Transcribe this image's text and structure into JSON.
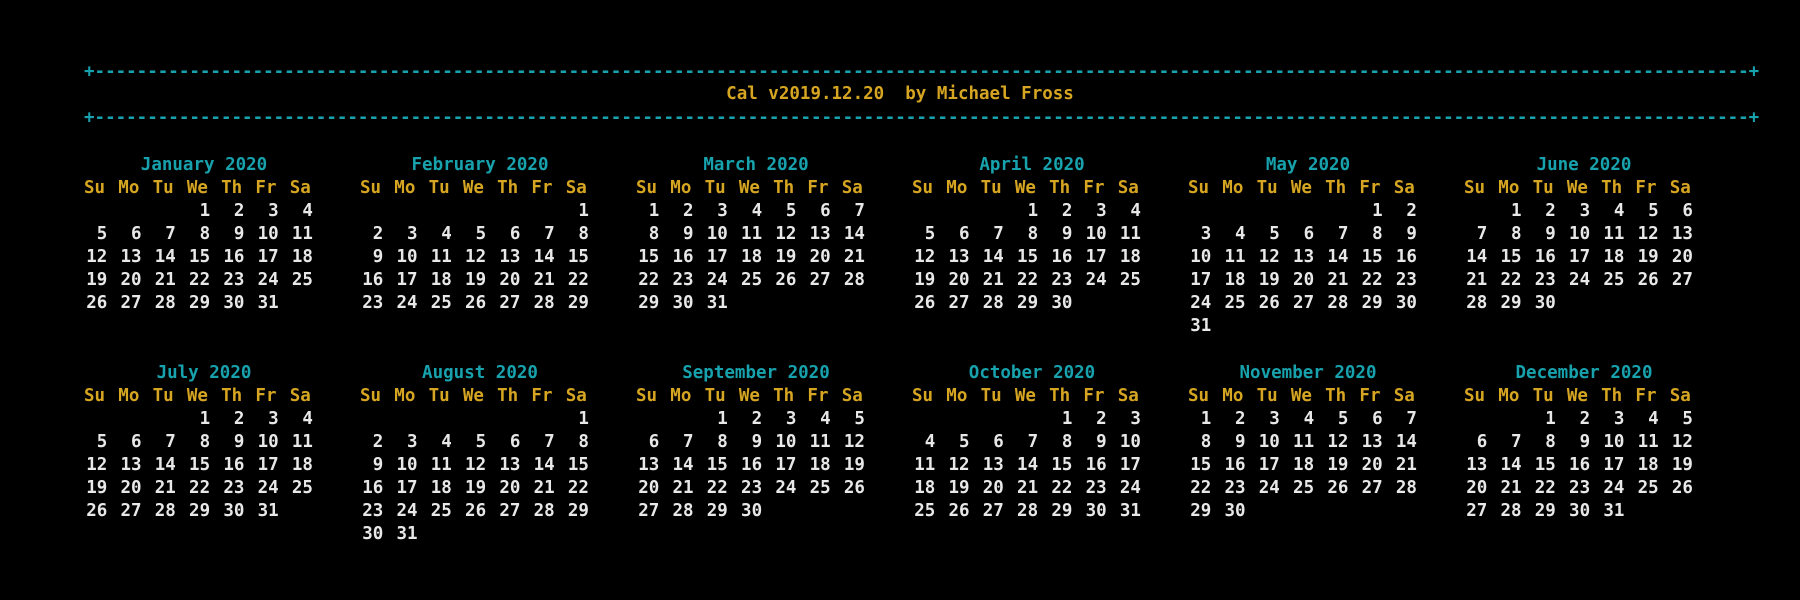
{
  "rule": "+-------------------------------------------------------------------------------------------------------------------------------------------------------------+",
  "title": "Cal v2019.12.20  by Michael Fross",
  "dow": [
    "Su",
    "Mo",
    "Tu",
    "We",
    "Th",
    "Fr",
    "Sa"
  ],
  "months": [
    {
      "name": "January 2020",
      "weeks": [
        [
          "",
          "",
          "",
          "1",
          "2",
          "3",
          "4"
        ],
        [
          "5",
          "6",
          "7",
          "8",
          "9",
          "10",
          "11"
        ],
        [
          "12",
          "13",
          "14",
          "15",
          "16",
          "17",
          "18"
        ],
        [
          "19",
          "20",
          "21",
          "22",
          "23",
          "24",
          "25"
        ],
        [
          "26",
          "27",
          "28",
          "29",
          "30",
          "31",
          ""
        ]
      ]
    },
    {
      "name": "February 2020",
      "weeks": [
        [
          "",
          "",
          "",
          "",
          "",
          "",
          "1"
        ],
        [
          "2",
          "3",
          "4",
          "5",
          "6",
          "7",
          "8"
        ],
        [
          "9",
          "10",
          "11",
          "12",
          "13",
          "14",
          "15"
        ],
        [
          "16",
          "17",
          "18",
          "19",
          "20",
          "21",
          "22"
        ],
        [
          "23",
          "24",
          "25",
          "26",
          "27",
          "28",
          "29"
        ]
      ]
    },
    {
      "name": "March 2020",
      "weeks": [
        [
          "1",
          "2",
          "3",
          "4",
          "5",
          "6",
          "7"
        ],
        [
          "8",
          "9",
          "10",
          "11",
          "12",
          "13",
          "14"
        ],
        [
          "15",
          "16",
          "17",
          "18",
          "19",
          "20",
          "21"
        ],
        [
          "22",
          "23",
          "24",
          "25",
          "26",
          "27",
          "28"
        ],
        [
          "29",
          "30",
          "31",
          "",
          "",
          "",
          ""
        ]
      ]
    },
    {
      "name": "April 2020",
      "weeks": [
        [
          "",
          "",
          "",
          "1",
          "2",
          "3",
          "4"
        ],
        [
          "5",
          "6",
          "7",
          "8",
          "9",
          "10",
          "11"
        ],
        [
          "12",
          "13",
          "14",
          "15",
          "16",
          "17",
          "18"
        ],
        [
          "19",
          "20",
          "21",
          "22",
          "23",
          "24",
          "25"
        ],
        [
          "26",
          "27",
          "28",
          "29",
          "30",
          "",
          ""
        ]
      ]
    },
    {
      "name": "May 2020",
      "weeks": [
        [
          "",
          "",
          "",
          "",
          "",
          "1",
          "2"
        ],
        [
          "3",
          "4",
          "5",
          "6",
          "7",
          "8",
          "9"
        ],
        [
          "10",
          "11",
          "12",
          "13",
          "14",
          "15",
          "16"
        ],
        [
          "17",
          "18",
          "19",
          "20",
          "21",
          "22",
          "23"
        ],
        [
          "24",
          "25",
          "26",
          "27",
          "28",
          "29",
          "30"
        ],
        [
          "31",
          "",
          "",
          "",
          "",
          "",
          ""
        ]
      ]
    },
    {
      "name": "June 2020",
      "weeks": [
        [
          "",
          "1",
          "2",
          "3",
          "4",
          "5",
          "6"
        ],
        [
          "7",
          "8",
          "9",
          "10",
          "11",
          "12",
          "13"
        ],
        [
          "14",
          "15",
          "16",
          "17",
          "18",
          "19",
          "20"
        ],
        [
          "21",
          "22",
          "23",
          "24",
          "25",
          "26",
          "27"
        ],
        [
          "28",
          "29",
          "30",
          "",
          "",
          "",
          ""
        ]
      ]
    },
    {
      "name": "July 2020",
      "weeks": [
        [
          "",
          "",
          "",
          "1",
          "2",
          "3",
          "4"
        ],
        [
          "5",
          "6",
          "7",
          "8",
          "9",
          "10",
          "11"
        ],
        [
          "12",
          "13",
          "14",
          "15",
          "16",
          "17",
          "18"
        ],
        [
          "19",
          "20",
          "21",
          "22",
          "23",
          "24",
          "25"
        ],
        [
          "26",
          "27",
          "28",
          "29",
          "30",
          "31",
          ""
        ]
      ]
    },
    {
      "name": "August 2020",
      "weeks": [
        [
          "",
          "",
          "",
          "",
          "",
          "",
          "1"
        ],
        [
          "2",
          "3",
          "4",
          "5",
          "6",
          "7",
          "8"
        ],
        [
          "9",
          "10",
          "11",
          "12",
          "13",
          "14",
          "15"
        ],
        [
          "16",
          "17",
          "18",
          "19",
          "20",
          "21",
          "22"
        ],
        [
          "23",
          "24",
          "25",
          "26",
          "27",
          "28",
          "29"
        ],
        [
          "30",
          "31",
          "",
          "",
          "",
          "",
          ""
        ]
      ]
    },
    {
      "name": "September 2020",
      "weeks": [
        [
          "",
          "",
          "1",
          "2",
          "3",
          "4",
          "5"
        ],
        [
          "6",
          "7",
          "8",
          "9",
          "10",
          "11",
          "12"
        ],
        [
          "13",
          "14",
          "15",
          "16",
          "17",
          "18",
          "19"
        ],
        [
          "20",
          "21",
          "22",
          "23",
          "24",
          "25",
          "26"
        ],
        [
          "27",
          "28",
          "29",
          "30",
          "",
          "",
          ""
        ]
      ]
    },
    {
      "name": "October 2020",
      "weeks": [
        [
          "",
          "",
          "",
          "",
          "1",
          "2",
          "3"
        ],
        [
          "4",
          "5",
          "6",
          "7",
          "8",
          "9",
          "10"
        ],
        [
          "11",
          "12",
          "13",
          "14",
          "15",
          "16",
          "17"
        ],
        [
          "18",
          "19",
          "20",
          "21",
          "22",
          "23",
          "24"
        ],
        [
          "25",
          "26",
          "27",
          "28",
          "29",
          "30",
          "31"
        ]
      ]
    },
    {
      "name": "November 2020",
      "weeks": [
        [
          "1",
          "2",
          "3",
          "4",
          "5",
          "6",
          "7"
        ],
        [
          "8",
          "9",
          "10",
          "11",
          "12",
          "13",
          "14"
        ],
        [
          "15",
          "16",
          "17",
          "18",
          "19",
          "20",
          "21"
        ],
        [
          "22",
          "23",
          "24",
          "25",
          "26",
          "27",
          "28"
        ],
        [
          "29",
          "30",
          "",
          "",
          "",
          "",
          ""
        ]
      ]
    },
    {
      "name": "December 2020",
      "weeks": [
        [
          "",
          "",
          "1",
          "2",
          "3",
          "4",
          "5"
        ],
        [
          "6",
          "7",
          "8",
          "9",
          "10",
          "11",
          "12"
        ],
        [
          "13",
          "14",
          "15",
          "16",
          "17",
          "18",
          "19"
        ],
        [
          "20",
          "21",
          "22",
          "23",
          "24",
          "25",
          "26"
        ],
        [
          "27",
          "28",
          "29",
          "30",
          "31",
          "",
          ""
        ]
      ]
    }
  ]
}
